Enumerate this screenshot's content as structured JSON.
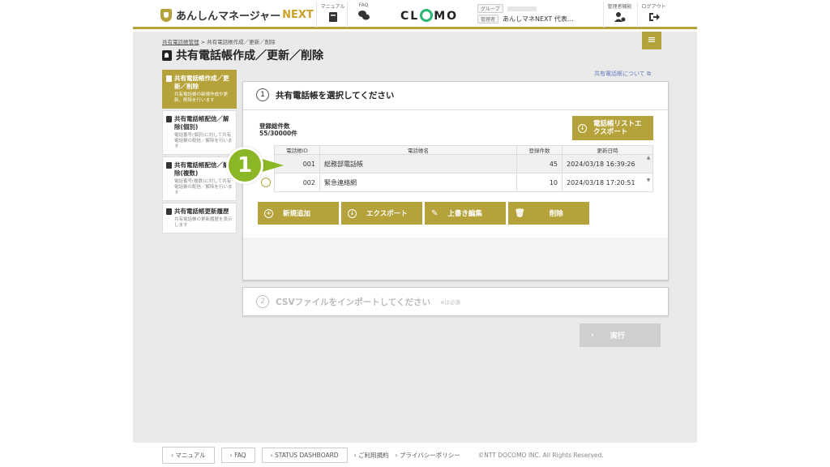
{
  "header": {
    "logo_text": "あんしんマネージャー",
    "logo_next": "NEXT",
    "manual_label": "マニュアル",
    "faq_label": "FAQ",
    "brand": "CLOMO",
    "group_tag": "グループ",
    "admin_tag": "管理者",
    "admin_name": "あんしマネNEXT 代表…",
    "admin_func_label": "管理者機能",
    "logout_label": "ログアウト"
  },
  "breadcrumb": {
    "parent": "共有電話帳管理",
    "sep": ">",
    "current": "共有電話帳作成／更新／削除"
  },
  "page_title": "共有電話帳作成／更新／削除",
  "about_link": "共有電話帳について",
  "sidebar": {
    "items": [
      {
        "title": "共有電話帳作成／更新／削除",
        "desc": "共有電話帳の新規作成や更新、削除を行います"
      },
      {
        "title": "共有電話帳配信／解除(個別)",
        "desc": "電話番号(個別)に対して共有電話帳の配信／解除を行います"
      },
      {
        "title": "共有電話帳配信／解除(複数)",
        "desc": "電話番号(複数)に対して共有電話帳の配信／解除を行います"
      },
      {
        "title": "共有電話帳更新履歴",
        "desc": "共有電話帳の更新履歴を表示します"
      }
    ]
  },
  "step1": {
    "num": "1",
    "title": "共有電話帳を選択してください",
    "count_label": "登録総件数",
    "count_value": "55/30000件",
    "export_list_button": "電話帳リストエクスポート",
    "columns": [
      "電話帳ID",
      "電話帳名",
      "登録件数",
      "更新日時"
    ],
    "rows": [
      {
        "id": "001",
        "name": "総務部電話帳",
        "count": "45",
        "updated": "2024/03/18 16:39:26"
      },
      {
        "id": "002",
        "name": "緊急連絡網",
        "count": "10",
        "updated": "2024/03/18 17:20:51"
      }
    ],
    "buttons": {
      "add": "新規追加",
      "export": "エクスポート",
      "overwrite": "上書き編集",
      "delete": "削除"
    }
  },
  "step2": {
    "num": "2",
    "title": "CSVファイルをインポートしてください",
    "note": "※は必須"
  },
  "execute_button": "実行",
  "callout_number": "1",
  "footer": {
    "manual": "マニュアル",
    "faq": "FAQ",
    "status": "STATUS DASHBOARD",
    "terms": "ご利用規約",
    "privacy": "プライバシーポリシー",
    "copyright": "©NTT DOCOMO INC. All Rights Reserved."
  },
  "colors": {
    "accent": "#b5a23a",
    "callout": "#8bb727",
    "content_bg": "#eaeaea"
  }
}
